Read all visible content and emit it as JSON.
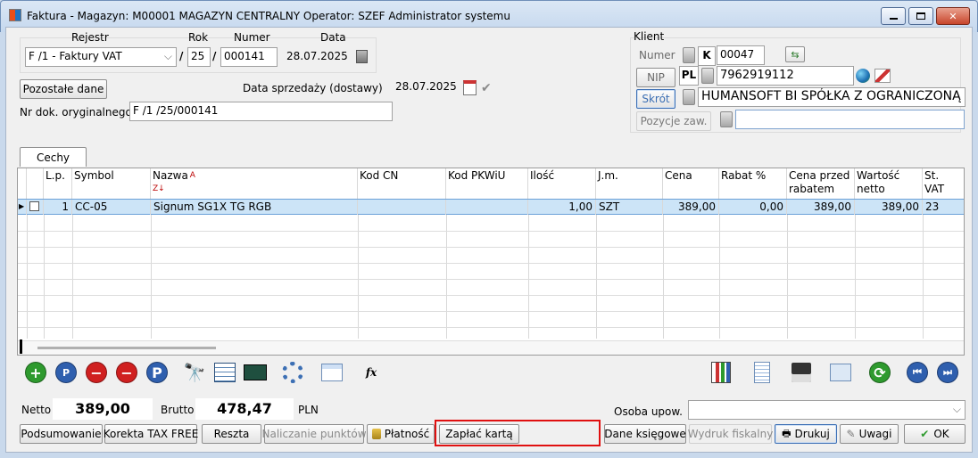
{
  "window": {
    "title": "Faktura - Magazyn: M00001 MAGAZYN CENTRALNY  Operator: SZEF Administrator systemu"
  },
  "header": {
    "rejestr_label": "Rejestr",
    "rok_label": "Rok",
    "numer_label": "Numer",
    "data_label": "Data",
    "rejestr_value": "F /1  - Faktury VAT",
    "rok_value": "25",
    "numer_value": "000141",
    "data_value": "28.07.2025",
    "separator": "/",
    "pozostale_label": "Pozostałe dane",
    "data_sprzedazy_label": "Data sprzedaży (dostawy)",
    "data_sprzedazy_value": "28.07.2025",
    "nr_dok_label": "Nr dok. oryginalnego",
    "nr_dok_value": "F /1  /25/000141"
  },
  "klient": {
    "title": "Klient",
    "numer_label": "Numer",
    "numer_prefix": "K",
    "numer_value": "00047",
    "nip_label": "NIP",
    "nip_prefix": "PL",
    "nip_value": "7962919112",
    "skrot_label": "Skrót",
    "skrot_value": "HUMANSOFT BI SPÓŁKA Z OGRANICZONĄ",
    "pozycje_label": "Pozycje zaw.",
    "pozycje_value": ""
  },
  "cechy_label": "Cechy",
  "table": {
    "columns": [
      {
        "line1": "L.p.",
        "line2": ""
      },
      {
        "line1": "Symbol",
        "line2": ""
      },
      {
        "line1": "Nazwa",
        "line2": ""
      },
      {
        "line1": "Kod  CN",
        "line2": ""
      },
      {
        "line1": "Kod  PKWiU",
        "line2": ""
      },
      {
        "line1": "Ilość",
        "line2": ""
      },
      {
        "line1": "J.m.",
        "line2": ""
      },
      {
        "line1": "Cena",
        "line2": ""
      },
      {
        "line1": "Rabat %",
        "line2": ""
      },
      {
        "line1": "Cena przed",
        "line2": "rabatem"
      },
      {
        "line1": "Wartość",
        "line2": "netto"
      },
      {
        "line1": "St.",
        "line2": "VAT"
      }
    ],
    "rows": [
      {
        "lp": "1",
        "symbol": "CC-05",
        "nazwa": "Signum SG1X TG RGB",
        "kod_cn": "",
        "kod_pkwiu": "",
        "ilosc": "1,00",
        "jm": "SZT",
        "cena": "389,00",
        "rabat": "0,00",
        "cena_przed": "389,00",
        "wartosc": "389,00",
        "vat": "23"
      }
    ]
  },
  "totals": {
    "netto_label": "Netto",
    "netto_value": "389,00",
    "brutto_label": "Brutto",
    "brutto_value": "478,47",
    "currency": "PLN",
    "osoba_label": "Osoba upow.",
    "osoba_value": ""
  },
  "buttons": {
    "podsumowanie": "Podsumowanie",
    "korekta": "Korekta TAX FREE",
    "reszta": "Reszta",
    "naliczanie": "Naliczanie punktów",
    "platnosc": "Płatność",
    "zaplac": "Zapłać kartą",
    "dane_ksiegowe": "Dane księgowe",
    "wydruk": "Wydruk fiskalny",
    "drukuj": "Drukuj",
    "uwagi": "Uwagi",
    "ok": "OK"
  },
  "toolbar_fx": "fx",
  "colors": {
    "accent": "#3c6fb4",
    "selection": "#cce4f7",
    "highlight": "#e01010"
  }
}
